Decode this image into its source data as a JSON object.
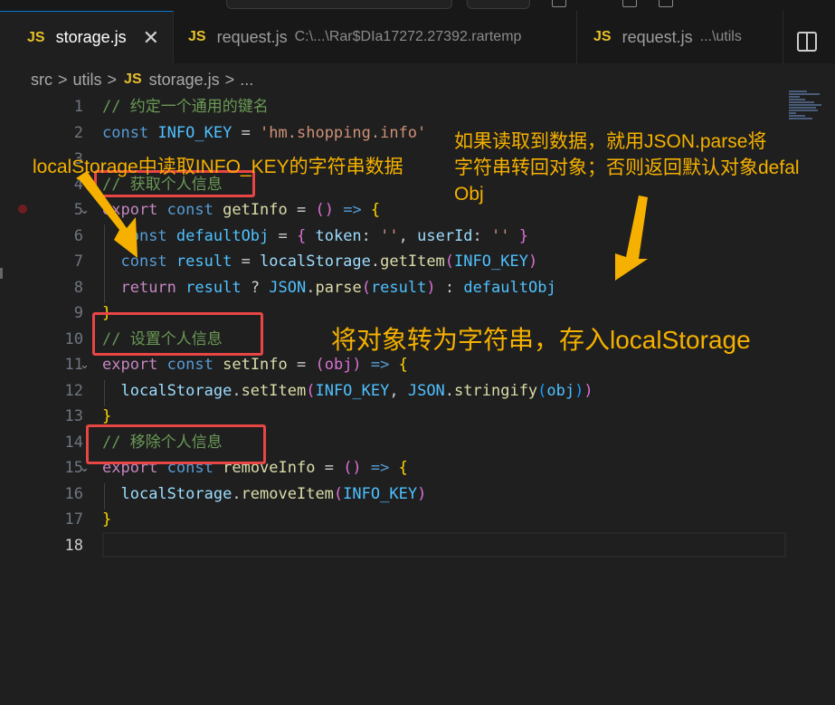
{
  "tabs": [
    {
      "badge": "JS",
      "name": "storage.js",
      "close": "✕",
      "desc": ""
    },
    {
      "badge": "JS",
      "name": "request.js",
      "desc": "C:\\...\\Rar$DIa17272.27392.rartemp"
    },
    {
      "badge": "JS",
      "name": "request.js",
      "desc": "...\\utils"
    }
  ],
  "breadcrumb": {
    "part1": "src",
    "part2": "utils",
    "badge": "JS",
    "file": "storage.js",
    "more": "...",
    "sep": ">"
  },
  "line_numbers": [
    "1",
    "2",
    "3",
    "4",
    "5",
    "6",
    "7",
    "8",
    "9",
    "10",
    "11",
    "12",
    "13",
    "14",
    "15",
    "16",
    "17",
    "18"
  ],
  "code": {
    "l1_comment": "// 约定一个通用的键名",
    "l2_const": "const",
    "l2_name": "INFO_KEY",
    "l2_eq": " = ",
    "l2_str": "'hm.shopping.info'",
    "l4_comment": "// 获取个人信息",
    "l5_export": "export",
    "l5_const": "const",
    "l5_name": "getInfo",
    "l5_eq": " = ",
    "l5_parens": "()",
    "l5_arrow": " => ",
    "l5_brace": "{",
    "l6_const": "const",
    "l6_name": "defaultObj",
    "l6_eq": " = ",
    "l6_open": "{",
    "l6_k1": " token",
    "l6_colon1": ": ",
    "l6_v1": "''",
    "l6_comma": ", ",
    "l6_k2": "userId",
    "l6_colon2": ": ",
    "l6_v2": "''",
    "l6_close": " }",
    "l7_const": "const",
    "l7_name": "result",
    "l7_eq": " = ",
    "l7_obj": "localStorage",
    "l7_dot": ".",
    "l7_fn": "getItem",
    "l7_open": "(",
    "l7_arg": "INFO_KEY",
    "l7_close": ")",
    "l8_return": "return",
    "l8_result": "result",
    "l8_q": " ? ",
    "l8_json": "JSON",
    "l8_dot": ".",
    "l8_fn": "parse",
    "l8_open": "(",
    "l8_arg": "result",
    "l8_close": ")",
    "l8_colon": " : ",
    "l8_default": "defaultObj",
    "l9_brace": "}",
    "l10_comment": "// 设置个人信息",
    "l11_export": "export",
    "l11_const": "const",
    "l11_name": "setInfo",
    "l11_eq": " = ",
    "l11_params": "(obj)",
    "l11_arrow": " => ",
    "l11_brace": "{",
    "l12_obj": "localStorage",
    "l12_dot": ".",
    "l12_fn": "setItem",
    "l12_open": "(",
    "l12_arg1": "INFO_KEY",
    "l12_comma": ", ",
    "l12_json": "JSON",
    "l12_dot2": ".",
    "l12_fn2": "stringify",
    "l12_open2": "(",
    "l12_arg2": "obj",
    "l12_close2": ")",
    "l12_close": ")",
    "l13_brace": "}",
    "l14_comment": "// 移除个人信息",
    "l15_export": "export",
    "l15_const": "const",
    "l15_name": "removeInfo",
    "l15_eq": " = ",
    "l15_parens": "()",
    "l15_arrow": " => ",
    "l15_brace": "{",
    "l16_obj": "localStorage",
    "l16_dot": ".",
    "l16_fn": "removeItem",
    "l16_open": "(",
    "l16_arg": "INFO_KEY",
    "l16_close": ")",
    "l17_brace": "}"
  },
  "annotations": {
    "left_note": "localStorage中读取INFO_KEY的字符串数据",
    "right_note_line1": "如果读取到数据，就用JSON.parse将",
    "right_note_line2": "字符串转回对象；否则返回默认对象defal",
    "right_note_line3": "Obj",
    "middle_note": "将对象转为字符串，存入localStorage"
  },
  "colors": {
    "annotation": "#f6b100",
    "highlight_box": "#e84545",
    "arrow": "#f6b100"
  }
}
